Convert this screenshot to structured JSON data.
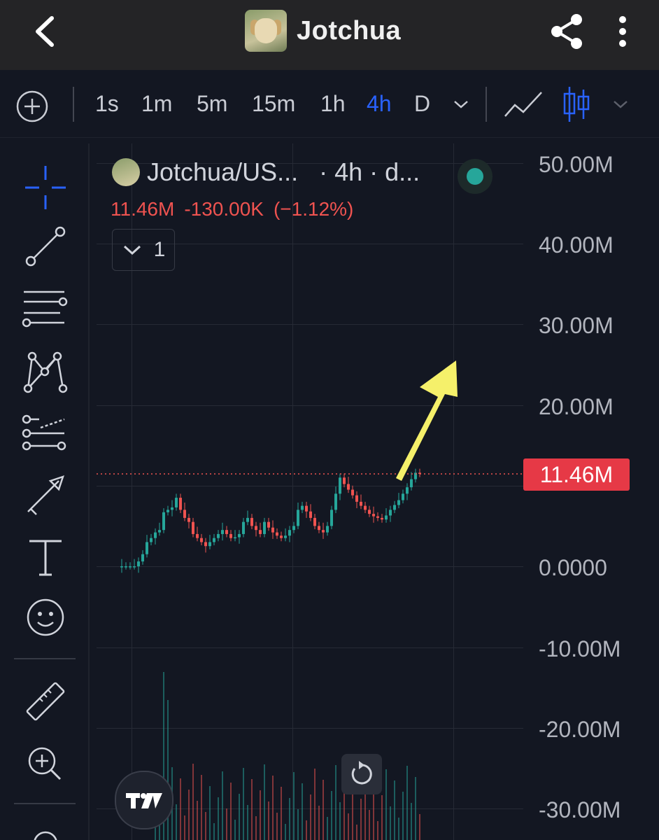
{
  "header": {
    "title": "Jotchua"
  },
  "toolbar": {
    "timeframes": [
      "1s",
      "1m",
      "5m",
      "15m",
      "1h",
      "4h",
      "D"
    ],
    "active_timeframe": "4h"
  },
  "legend": {
    "symbol": "Jotchua/US...",
    "interval": "· 4h · d...",
    "last_price": "11.46M",
    "change": "-130.00K",
    "change_pct": "(−1.12%)",
    "indicator_count": "1"
  },
  "y_axis": {
    "labels": [
      "50.00M",
      "40.00M",
      "30.00M",
      "20.00M",
      "0.0000",
      "-10.00M",
      "-20.00M",
      "-30.00M"
    ]
  },
  "price_tag": "11.46M",
  "colors": {
    "up": "#26a69a",
    "down": "#ef5350",
    "accent": "#2962ff",
    "price_tag": "#e63946",
    "arrow": "#f5f06a"
  },
  "chart_data": {
    "type": "candlestick",
    "y_unit": "M",
    "ylim": [
      -30,
      50
    ],
    "last_price": 11.46,
    "close_series": [
      0,
      0,
      0,
      0,
      0.6,
      1.5,
      3,
      3.5,
      4.2,
      4.5,
      6.7,
      7,
      7.3,
      8.5,
      7,
      6,
      5.5,
      4,
      3.5,
      3,
      2.5,
      3,
      3.5,
      4,
      4.5,
      4,
      3.5,
      3.6,
      4,
      5.5,
      6,
      5,
      4.5,
      4,
      5.5,
      4.8,
      4.2,
      3.8,
      3.5,
      3.8,
      4.5,
      5,
      7,
      7.5,
      6.8,
      6,
      5,
      4.5,
      4.2,
      5,
      7,
      9,
      11,
      10.2,
      9.5,
      8.8,
      8,
      7.5,
      7,
      6.5,
      6.2,
      6,
      5.8,
      6.3,
      7,
      7.6,
      8.2,
      9,
      9.8,
      10.8,
      11.6,
      11.46
    ],
    "volume_note": "volume bars shown at bottom"
  }
}
